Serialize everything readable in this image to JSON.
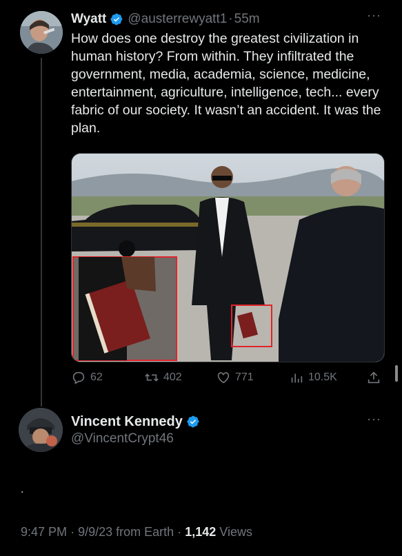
{
  "tweet": {
    "author_name": "Wyatt",
    "author_handle": "@austerrewyatt1",
    "separator": "·",
    "time_ago": "55m",
    "more": "···",
    "text": "How does one destroy the greatest civilization in human history? From within. They infiltrated the government, media, academia, science, medicine, entertainment, agriculture, intelligence, tech... every fabric of our society. It wasn’t an accident. It was the plan.",
    "actions": {
      "replies": "62",
      "retweets": "402",
      "likes": "771",
      "views": "10.5K"
    }
  },
  "reply": {
    "author_name": "Vincent Kennedy",
    "author_handle": "@VincentCrypt46",
    "more": "···",
    "text": ".",
    "time": "9:47 PM",
    "sep1": "·",
    "date": "9/9/23",
    "source": "from Earth",
    "sep2": "·",
    "views_count": "1,142",
    "views_label": "Views"
  },
  "colors": {
    "background": "#000000",
    "text": "#e7e9ea",
    "secondary": "#71767b",
    "verified": "#1d9bf0",
    "highlight_box": "#e0242a"
  },
  "icons": [
    "verified-badge-icon",
    "reply-icon",
    "retweet-icon",
    "like-icon",
    "views-icon",
    "share-icon",
    "more-icon"
  ]
}
